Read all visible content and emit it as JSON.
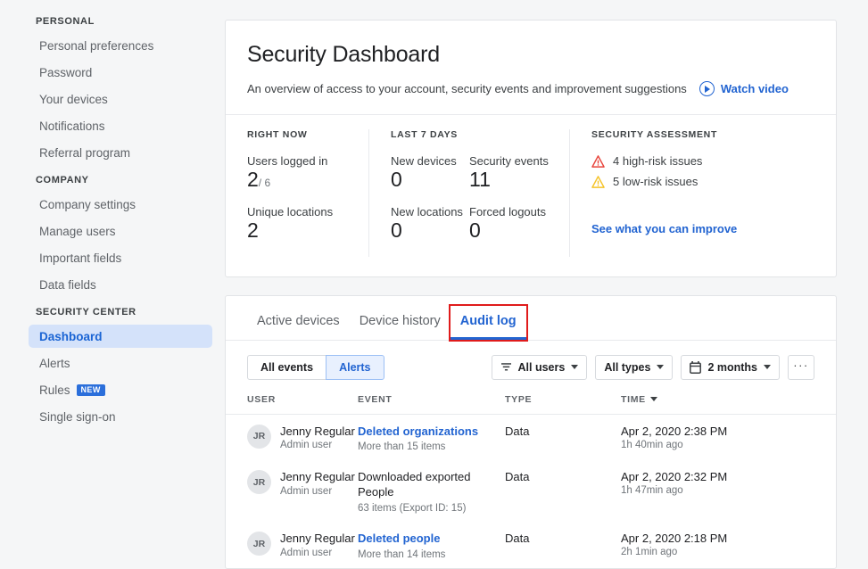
{
  "sidebar": {
    "groups": [
      {
        "title": "PERSONAL",
        "items": [
          {
            "label": "Personal preferences",
            "active": false
          },
          {
            "label": "Password",
            "active": false
          },
          {
            "label": "Your devices",
            "active": false
          },
          {
            "label": "Notifications",
            "active": false
          },
          {
            "label": "Referral program",
            "active": false
          }
        ]
      },
      {
        "title": "COMPANY",
        "items": [
          {
            "label": "Company settings",
            "active": false
          },
          {
            "label": "Manage users",
            "active": false
          },
          {
            "label": "Important fields",
            "active": false
          },
          {
            "label": "Data fields",
            "active": false
          }
        ]
      },
      {
        "title": "SECURITY CENTER",
        "items": [
          {
            "label": "Dashboard",
            "active": true
          },
          {
            "label": "Alerts",
            "active": false
          },
          {
            "label": "Rules",
            "active": false,
            "badge": "NEW"
          },
          {
            "label": "Single sign-on",
            "active": false
          }
        ]
      }
    ]
  },
  "header": {
    "title": "Security Dashboard",
    "subtitle": "An overview of access to your account, security events and improvement suggestions",
    "watch_video_label": "Watch video",
    "watch_video_icon": "play-circle-icon"
  },
  "stats": {
    "right_now": {
      "heading": "RIGHT NOW",
      "items": [
        {
          "label": "Users logged in",
          "value": "2",
          "sub": "/ 6"
        },
        {
          "label": "Unique locations",
          "value": "2",
          "sub": ""
        }
      ]
    },
    "last_7_days": {
      "heading": "LAST 7 DAYS",
      "items": [
        {
          "label": "New devices",
          "value": "0"
        },
        {
          "label": "Security events",
          "value": "11"
        },
        {
          "label": "New locations",
          "value": "0"
        },
        {
          "label": "Forced logouts",
          "value": "0"
        }
      ]
    },
    "assessment": {
      "heading": "SECURITY ASSESSMENT",
      "risks": [
        {
          "label": "4 high-risk issues",
          "icon": "warning-triangle-icon",
          "color": "#e8453c"
        },
        {
          "label": "5 low-risk issues",
          "icon": "warning-triangle-icon",
          "color": "#f5c328"
        }
      ],
      "improve_link": "See what you can improve"
    }
  },
  "tabs": [
    {
      "label": "Active devices",
      "active": false,
      "highlighted": false
    },
    {
      "label": "Device history",
      "active": false,
      "highlighted": false
    },
    {
      "label": "Audit log",
      "active": true,
      "highlighted": true
    }
  ],
  "toolbar": {
    "segmented": [
      {
        "label": "All events",
        "selected": false
      },
      {
        "label": "Alerts",
        "selected": true
      }
    ],
    "filters": [
      {
        "label": "All users",
        "icon": "filter-funnel-icon"
      },
      {
        "label": "All types",
        "icon": ""
      },
      {
        "label": "2 months",
        "icon": "calendar-icon"
      }
    ],
    "overflow_label": "···"
  },
  "table": {
    "columns": [
      "USER",
      "EVENT",
      "TYPE",
      "TIME"
    ],
    "sorted_column": "TIME",
    "rows": [
      {
        "initials": "JR",
        "user_name": "Jenny Regular",
        "user_role": "Admin user",
        "event": "Deleted organizations",
        "event_is_link": true,
        "event_sub": "More than 15 items",
        "type": "Data",
        "time": "Apr 2, 2020 2:38 PM",
        "time_ago": "1h 40min ago"
      },
      {
        "initials": "JR",
        "user_name": "Jenny Regular",
        "user_role": "Admin user",
        "event": "Downloaded exported People",
        "event_is_link": false,
        "event_sub": "63 items (Export ID: 15)",
        "type": "Data",
        "time": "Apr 2, 2020 2:32 PM",
        "time_ago": "1h 47min ago"
      },
      {
        "initials": "JR",
        "user_name": "Jenny Regular",
        "user_role": "Admin user",
        "event": "Deleted people",
        "event_is_link": true,
        "event_sub": "More than 14 items",
        "type": "Data",
        "time": "Apr 2, 2020 2:18 PM",
        "time_ago": "2h 1min ago"
      }
    ]
  }
}
